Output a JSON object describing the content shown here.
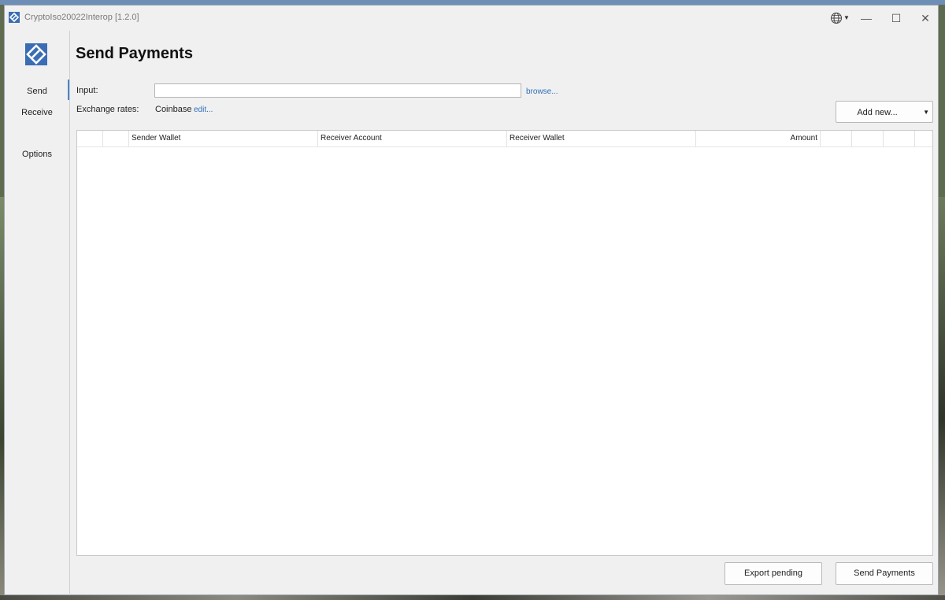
{
  "window": {
    "title": "CryptoIso20022Interop [1.2.0]",
    "minimize": "—",
    "maximize": "☐",
    "close": "✕"
  },
  "sidebar": {
    "items": [
      {
        "label": "Send",
        "active": true
      },
      {
        "label": "Receive",
        "active": false
      },
      {
        "label": "Options",
        "active": false
      }
    ]
  },
  "page": {
    "title": "Send Payments",
    "input_label": "Input:",
    "input_value": "",
    "browse_link": "browse...",
    "exchange_label": "Exchange rates:",
    "exchange_value": "Coinbase",
    "edit_link": "edit...",
    "add_new_label": "Add new..."
  },
  "table": {
    "columns": [
      "",
      "",
      "Sender Wallet",
      "Receiver Account",
      "Receiver Wallet",
      "Amount",
      "",
      "",
      ""
    ],
    "rows": []
  },
  "footer": {
    "export_label": "Export pending",
    "send_label": "Send Payments"
  },
  "colors": {
    "accent": "#4a86c8",
    "link": "#2f6fb7",
    "window_bg": "#f0f0f0"
  }
}
